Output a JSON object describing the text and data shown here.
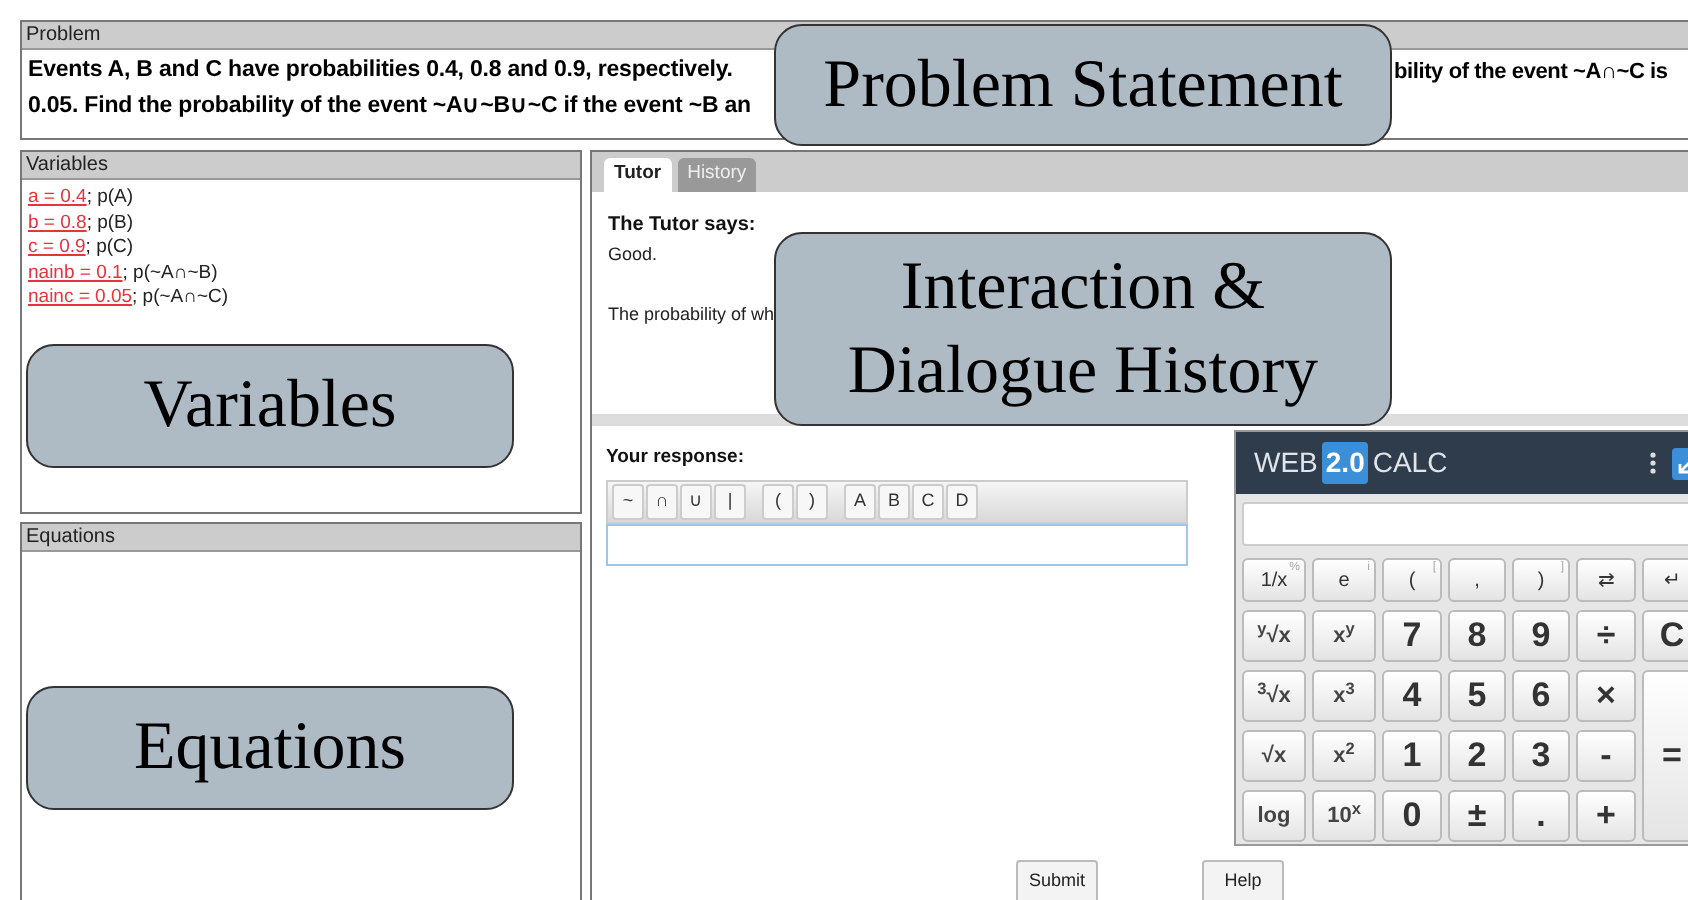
{
  "problem": {
    "title": "Problem",
    "lines": [
      {
        "left": "Events A, B and C have probabilities 0.4, 0.8 and 0.9, respectively.",
        "right": "bility of the event ~A∩~C is"
      },
      {
        "left": "0.05. Find the probability of the event ~A∪~B∪~C if the event ~B an"
      }
    ],
    "callout": "Problem Statement"
  },
  "variables": {
    "title": "Variables",
    "items": [
      {
        "link": "a = 0.4",
        "text": "; p(A)"
      },
      {
        "link": "b = 0.8",
        "text": "; p(B)"
      },
      {
        "link": "c = 0.9",
        "text": "; p(C)"
      },
      {
        "link": "nainb = 0.1",
        "text": "; p(~A∩~B)"
      },
      {
        "link": "nainc = 0.05",
        "text": "; p(~A∩~C)"
      }
    ],
    "callout": "Variables"
  },
  "equations": {
    "title": "Equations",
    "callout": "Equations"
  },
  "tabs": [
    {
      "label": "Tutor",
      "selected": true
    },
    {
      "label": "History",
      "selected": false
    }
  ],
  "dialogue": {
    "heading": "The Tutor says:",
    "lines": [
      "Good.",
      "The probability of wh"
    ],
    "callout": "Interaction & Dialogue History"
  },
  "response": {
    "label": "Your response:",
    "toolbar": [
      [
        "~",
        "∩",
        "∪",
        "|"
      ],
      [
        "(",
        ")"
      ],
      [
        "A",
        "B",
        "C",
        "D"
      ]
    ]
  },
  "calculator": {
    "brand": [
      "WEB",
      "2.0",
      "CALC"
    ],
    "keys": [
      [
        {
          "label": "1/x",
          "alt": "%",
          "kind": "top"
        },
        {
          "label": "e",
          "alt": "i",
          "kind": "top"
        },
        {
          "label": "(",
          "alt": "[",
          "kind": "top"
        },
        {
          "label": ",",
          "kind": "top"
        },
        {
          "label": ")",
          "alt": "]",
          "kind": "top"
        },
        {
          "label": "⇄",
          "kind": "top"
        },
        {
          "label": "↵",
          "kind": "top"
        }
      ],
      [
        {
          "label": "$^{y}$√x",
          "kind": "fn"
        },
        {
          "label": "x$^{y}$",
          "kind": "fn"
        },
        {
          "label": "7",
          "kind": "num"
        },
        {
          "label": "8",
          "kind": "num"
        },
        {
          "label": "9",
          "kind": "num"
        },
        {
          "label": "÷",
          "kind": "num"
        },
        {
          "label": "C",
          "kind": "num"
        }
      ],
      [
        {
          "label": "$^{3}$√x",
          "kind": "fn"
        },
        {
          "label": "x$^{3}$",
          "kind": "fn"
        },
        {
          "label": "4",
          "kind": "num"
        },
        {
          "label": "5",
          "kind": "num"
        },
        {
          "label": "6",
          "kind": "num"
        },
        {
          "label": "×",
          "kind": "num"
        },
        {
          "label": "=",
          "kind": "tall"
        }
      ],
      [
        {
          "label": "√x",
          "kind": "fn"
        },
        {
          "label": "x$^{2}$",
          "kind": "fn"
        },
        {
          "label": "1",
          "kind": "num"
        },
        {
          "label": "2",
          "kind": "num"
        },
        {
          "label": "3",
          "kind": "num"
        },
        {
          "label": "-",
          "kind": "num"
        }
      ],
      [
        {
          "label": "log",
          "kind": "fn"
        },
        {
          "label": "10$^{x}$",
          "kind": "fn"
        },
        {
          "label": "0",
          "kind": "num"
        },
        {
          "label": "±",
          "kind": "num"
        },
        {
          "label": ".",
          "kind": "num"
        },
        {
          "label": "+",
          "kind": "num"
        }
      ]
    ]
  },
  "buttons": [
    "Submit",
    "Help"
  ]
}
